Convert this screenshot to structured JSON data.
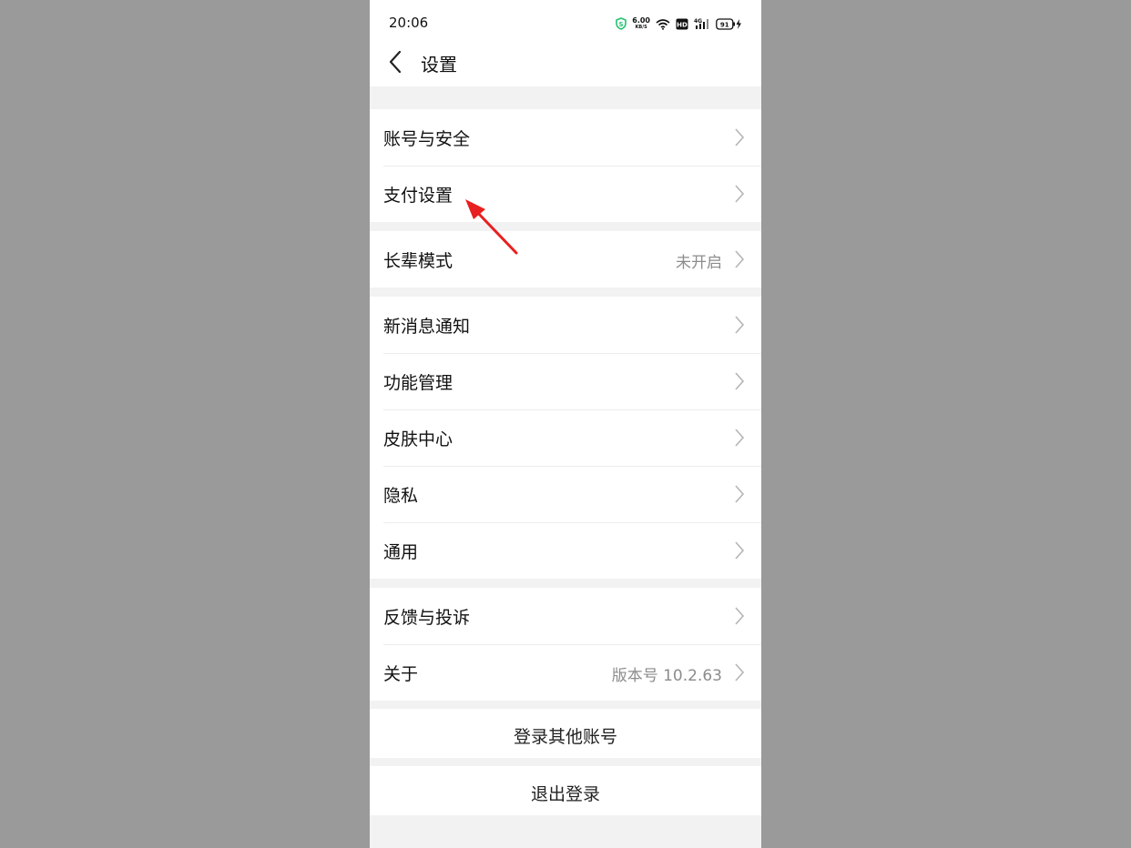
{
  "status": {
    "time": "20:06",
    "net_speed_value": "6.00",
    "net_speed_unit": "KB/S",
    "hd_label": "HD",
    "network_label": "4G",
    "battery": "91"
  },
  "header": {
    "title": "设置"
  },
  "sections": [
    {
      "items": [
        {
          "label": "账号与安全"
        },
        {
          "label": "支付设置"
        }
      ]
    },
    {
      "items": [
        {
          "label": "长辈模式",
          "value": "未开启"
        }
      ]
    },
    {
      "items": [
        {
          "label": "新消息通知"
        },
        {
          "label": "功能管理"
        },
        {
          "label": "皮肤中心"
        },
        {
          "label": "隐私"
        },
        {
          "label": "通用"
        }
      ]
    },
    {
      "items": [
        {
          "label": "反馈与投诉"
        },
        {
          "label": "关于",
          "value": "版本号 10.2.63"
        }
      ]
    }
  ],
  "actions": {
    "switch_account": "登录其他账号",
    "logout": "退出登录"
  },
  "colors": {
    "accent_arrow": "#e8201f",
    "chevron": "#b5b5b5",
    "shield": "#25c16f"
  }
}
